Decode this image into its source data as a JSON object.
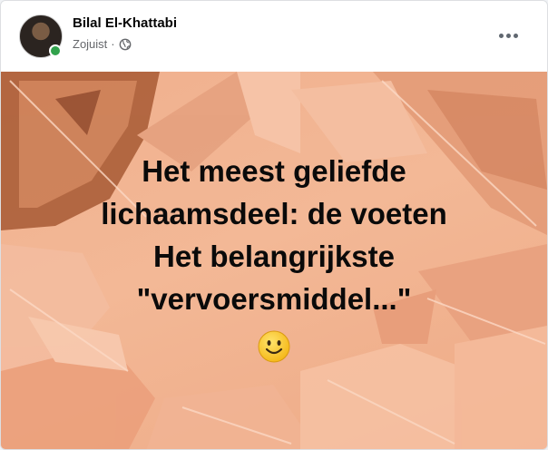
{
  "post": {
    "author": "Bilal El-Khattabi",
    "time": "Zojuist",
    "separator": "·",
    "audience_icon": "globe-icon",
    "more_icon": "more-options-icon"
  },
  "content": {
    "lines": [
      "Het meest geliefde",
      "lichaamsdeel: de voeten",
      "Het belangrijkste",
      "\"vervoersmiddel...\""
    ],
    "emoji_icon": "smiley-emoji-icon",
    "background_color": "#f3b896",
    "text_color": "#0a0a0a"
  }
}
